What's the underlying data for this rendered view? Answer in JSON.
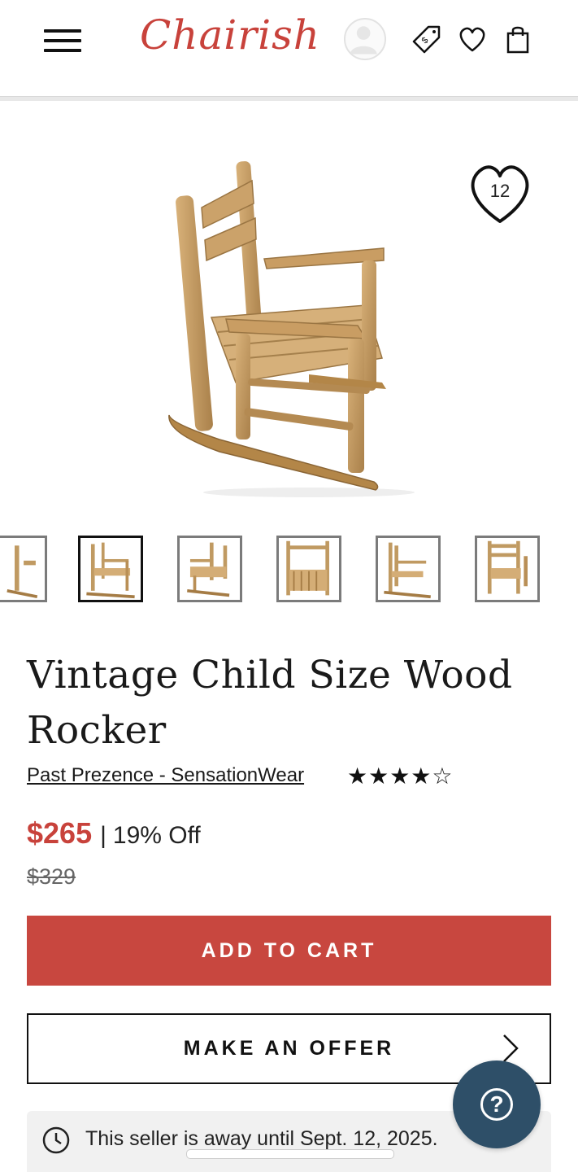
{
  "header": {
    "logo_text": "Chairish",
    "menu_icon": "hamburger-menu-icon",
    "avatar_icon": "user-avatar-icon",
    "icons": [
      "price-tag-icon",
      "heart-icon",
      "shopping-bag-icon"
    ]
  },
  "product": {
    "favorites_count": "12",
    "title": "Vintage Child Size Wood Rocker",
    "seller": "Past Prezence - SensationWear",
    "rating_stars": "★★★★☆",
    "rating": 3.5,
    "price": "$265",
    "separator": "|",
    "discount": "19% Off",
    "original_price": "$329",
    "thumbnail_count": 6,
    "active_thumbnail": 2
  },
  "actions": {
    "add_to_cart": "ADD TO CART",
    "make_offer": "MAKE AN OFFER"
  },
  "notice": {
    "away_text": "This seller is away until Sept. 12, 2025."
  },
  "help": {
    "label": "?"
  },
  "colors": {
    "brand_red": "#c8423b",
    "help_navy": "#2e4f68"
  }
}
